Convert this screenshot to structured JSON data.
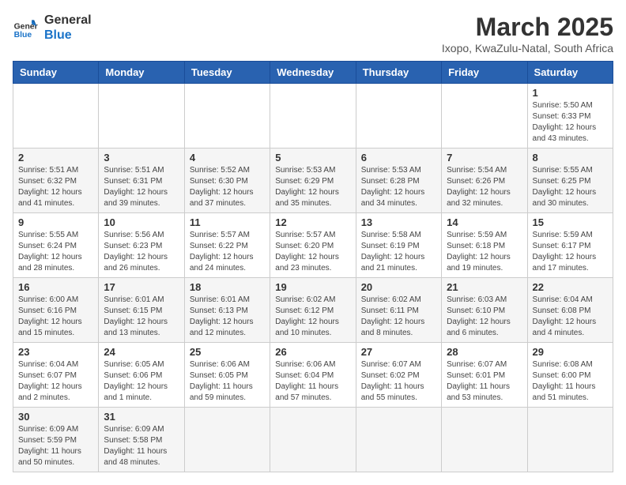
{
  "header": {
    "logo_general": "General",
    "logo_blue": "Blue",
    "month": "March 2025",
    "location": "Ixopo, KwaZulu-Natal, South Africa"
  },
  "weekdays": [
    "Sunday",
    "Monday",
    "Tuesday",
    "Wednesday",
    "Thursday",
    "Friday",
    "Saturday"
  ],
  "weeks": [
    [
      {
        "day": "",
        "info": ""
      },
      {
        "day": "",
        "info": ""
      },
      {
        "day": "",
        "info": ""
      },
      {
        "day": "",
        "info": ""
      },
      {
        "day": "",
        "info": ""
      },
      {
        "day": "",
        "info": ""
      },
      {
        "day": "1",
        "info": "Sunrise: 5:50 AM\nSunset: 6:33 PM\nDaylight: 12 hours\nand 43 minutes."
      }
    ],
    [
      {
        "day": "2",
        "info": "Sunrise: 5:51 AM\nSunset: 6:32 PM\nDaylight: 12 hours\nand 41 minutes."
      },
      {
        "day": "3",
        "info": "Sunrise: 5:51 AM\nSunset: 6:31 PM\nDaylight: 12 hours\nand 39 minutes."
      },
      {
        "day": "4",
        "info": "Sunrise: 5:52 AM\nSunset: 6:30 PM\nDaylight: 12 hours\nand 37 minutes."
      },
      {
        "day": "5",
        "info": "Sunrise: 5:53 AM\nSunset: 6:29 PM\nDaylight: 12 hours\nand 35 minutes."
      },
      {
        "day": "6",
        "info": "Sunrise: 5:53 AM\nSunset: 6:28 PM\nDaylight: 12 hours\nand 34 minutes."
      },
      {
        "day": "7",
        "info": "Sunrise: 5:54 AM\nSunset: 6:26 PM\nDaylight: 12 hours\nand 32 minutes."
      },
      {
        "day": "8",
        "info": "Sunrise: 5:55 AM\nSunset: 6:25 PM\nDaylight: 12 hours\nand 30 minutes."
      }
    ],
    [
      {
        "day": "9",
        "info": "Sunrise: 5:55 AM\nSunset: 6:24 PM\nDaylight: 12 hours\nand 28 minutes."
      },
      {
        "day": "10",
        "info": "Sunrise: 5:56 AM\nSunset: 6:23 PM\nDaylight: 12 hours\nand 26 minutes."
      },
      {
        "day": "11",
        "info": "Sunrise: 5:57 AM\nSunset: 6:22 PM\nDaylight: 12 hours\nand 24 minutes."
      },
      {
        "day": "12",
        "info": "Sunrise: 5:57 AM\nSunset: 6:20 PM\nDaylight: 12 hours\nand 23 minutes."
      },
      {
        "day": "13",
        "info": "Sunrise: 5:58 AM\nSunset: 6:19 PM\nDaylight: 12 hours\nand 21 minutes."
      },
      {
        "day": "14",
        "info": "Sunrise: 5:59 AM\nSunset: 6:18 PM\nDaylight: 12 hours\nand 19 minutes."
      },
      {
        "day": "15",
        "info": "Sunrise: 5:59 AM\nSunset: 6:17 PM\nDaylight: 12 hours\nand 17 minutes."
      }
    ],
    [
      {
        "day": "16",
        "info": "Sunrise: 6:00 AM\nSunset: 6:16 PM\nDaylight: 12 hours\nand 15 minutes."
      },
      {
        "day": "17",
        "info": "Sunrise: 6:01 AM\nSunset: 6:15 PM\nDaylight: 12 hours\nand 13 minutes."
      },
      {
        "day": "18",
        "info": "Sunrise: 6:01 AM\nSunset: 6:13 PM\nDaylight: 12 hours\nand 12 minutes."
      },
      {
        "day": "19",
        "info": "Sunrise: 6:02 AM\nSunset: 6:12 PM\nDaylight: 12 hours\nand 10 minutes."
      },
      {
        "day": "20",
        "info": "Sunrise: 6:02 AM\nSunset: 6:11 PM\nDaylight: 12 hours\nand 8 minutes."
      },
      {
        "day": "21",
        "info": "Sunrise: 6:03 AM\nSunset: 6:10 PM\nDaylight: 12 hours\nand 6 minutes."
      },
      {
        "day": "22",
        "info": "Sunrise: 6:04 AM\nSunset: 6:08 PM\nDaylight: 12 hours\nand 4 minutes."
      }
    ],
    [
      {
        "day": "23",
        "info": "Sunrise: 6:04 AM\nSunset: 6:07 PM\nDaylight: 12 hours\nand 2 minutes."
      },
      {
        "day": "24",
        "info": "Sunrise: 6:05 AM\nSunset: 6:06 PM\nDaylight: 12 hours\nand 1 minute."
      },
      {
        "day": "25",
        "info": "Sunrise: 6:06 AM\nSunset: 6:05 PM\nDaylight: 11 hours\nand 59 minutes."
      },
      {
        "day": "26",
        "info": "Sunrise: 6:06 AM\nSunset: 6:04 PM\nDaylight: 11 hours\nand 57 minutes."
      },
      {
        "day": "27",
        "info": "Sunrise: 6:07 AM\nSunset: 6:02 PM\nDaylight: 11 hours\nand 55 minutes."
      },
      {
        "day": "28",
        "info": "Sunrise: 6:07 AM\nSunset: 6:01 PM\nDaylight: 11 hours\nand 53 minutes."
      },
      {
        "day": "29",
        "info": "Sunrise: 6:08 AM\nSunset: 6:00 PM\nDaylight: 11 hours\nand 51 minutes."
      }
    ],
    [
      {
        "day": "30",
        "info": "Sunrise: 6:09 AM\nSunset: 5:59 PM\nDaylight: 11 hours\nand 50 minutes."
      },
      {
        "day": "31",
        "info": "Sunrise: 6:09 AM\nSunset: 5:58 PM\nDaylight: 11 hours\nand 48 minutes."
      },
      {
        "day": "",
        "info": ""
      },
      {
        "day": "",
        "info": ""
      },
      {
        "day": "",
        "info": ""
      },
      {
        "day": "",
        "info": ""
      },
      {
        "day": "",
        "info": ""
      }
    ]
  ]
}
